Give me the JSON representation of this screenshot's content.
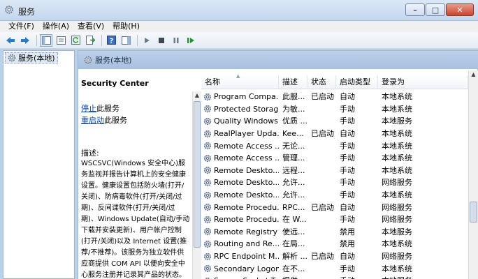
{
  "window": {
    "title": "服务"
  },
  "menu": [
    "文件(F)",
    "操作(A)",
    "查看(V)",
    "帮助(H)"
  ],
  "toolbar": {
    "icons": [
      "back-arrow-icon",
      "forward-arrow-icon",
      "console-tree-icon",
      "properties-icon",
      "refresh-icon",
      "export-icon",
      "help-icon",
      "show-hide-icon",
      "start-service-icon",
      "stop-service-icon",
      "pause-service-icon",
      "restart-service-icon"
    ]
  },
  "tree": {
    "root": "服务(本地)"
  },
  "pane": {
    "header": "服务(本地)"
  },
  "description": {
    "service_name": "Security Center",
    "stop_link": "停止",
    "stop_suffix": "此服务",
    "restart_link": "重启动",
    "restart_suffix": "此服务",
    "label": "描述:",
    "lines": [
      "WSCSVC(Windows 安全中心)服",
      "务监视并报告计算机上的安全健康",
      "设置。健康设置包括防火墙(打开/",
      "关闭)、防病毒软件(打开/关闭/过",
      "期)、反间谍软件(打开/关闭/过",
      "期)、Windows Update(自动/手动",
      "下载并安装更新)、用户帐户控制",
      "(打开/关闭)以及 Internet 设置(推",
      "荐/不推荐)。该服务为独立软件供",
      "应商提供 COM API 以便向安全中",
      "心服务注册并记录其产品的状态。"
    ]
  },
  "table": {
    "columns": [
      "名称",
      "描述",
      "状态",
      "启动类型",
      "登录为"
    ],
    "rows": [
      [
        "Program Compa...",
        "此服...",
        "已启动",
        "自动",
        "本地系统"
      ],
      [
        "Protected Storage",
        "为敏...",
        "",
        "手动",
        "本地系统"
      ],
      [
        "Quality Windows...",
        "优质 ...",
        "",
        "手动",
        "本地服务"
      ],
      [
        "RealPlayer Upda...",
        "Kee...",
        "已启动",
        "自动",
        "本地系统"
      ],
      [
        "Remote Access ...",
        "无论...",
        "",
        "手动",
        "本地系统"
      ],
      [
        "Remote Access ...",
        "管理...",
        "",
        "手动",
        "本地系统"
      ],
      [
        "Remote Deskto...",
        "远程...",
        "",
        "手动",
        "本地系统"
      ],
      [
        "Remote Deskto...",
        "允许...",
        "",
        "手动",
        "网络服务"
      ],
      [
        "Remote Deskto...",
        "允许...",
        "",
        "手动",
        "本地系统"
      ],
      [
        "Remote Procedu...",
        "RPC...",
        "已启动",
        "自动",
        "网络服务"
      ],
      [
        "Remote Procedu...",
        "在 W...",
        "",
        "手动",
        "网络服务"
      ],
      [
        "Remote Registry",
        "使远...",
        "",
        "禁用",
        "本地服务"
      ],
      [
        "Routing and Re...",
        "在局...",
        "",
        "禁用",
        "本地系统"
      ],
      [
        "RPC Endpoint M...",
        "解析 ...",
        "已启动",
        "自动",
        "网络服务"
      ],
      [
        "Secondary Logon",
        "在不...",
        "",
        "手动",
        "本地系统"
      ],
      [
        "Secure Socket T...",
        "提供...",
        "",
        "手动",
        "本地服务"
      ]
    ]
  }
}
